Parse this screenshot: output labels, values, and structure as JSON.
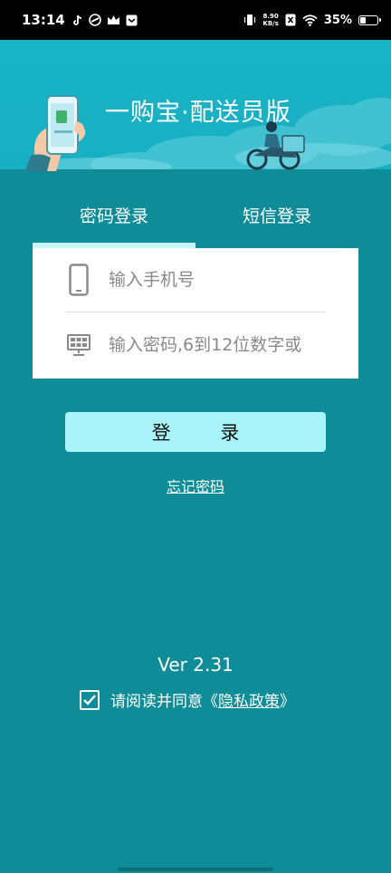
{
  "status_bar": {
    "time": "13:14",
    "net_speed_value": "8.90",
    "net_speed_unit": "KB/s",
    "battery_text": "35%",
    "battery_level": 0.35,
    "icons": [
      "tiktok-icon",
      "app-icon",
      "crown-icon",
      "mail-icon",
      "vibrate-icon",
      "sim-icon",
      "wifi-icon",
      "battery-icon"
    ]
  },
  "header": {
    "title": "一购宝·配送员版"
  },
  "tabs": [
    {
      "label": "密码登录",
      "active": true
    },
    {
      "label": "短信登录",
      "active": false
    }
  ],
  "form": {
    "phone_placeholder": "输入手机号",
    "password_placeholder": "输入密码,6到12位数字或"
  },
  "buttons": {
    "login_label": "登 录",
    "forgot_label": "忘记密码"
  },
  "footer": {
    "version": "Ver 2.31",
    "agree_prefix": "请阅读并同意",
    "bracket_open": "《",
    "policy_label": "隐私政策",
    "bracket_close": "》",
    "agree_checked": true
  },
  "colors": {
    "background": "#0e8c98",
    "banner": "#17b0c3",
    "button": "#a9f4f8",
    "tab_indicator": "#c8f5f8"
  }
}
